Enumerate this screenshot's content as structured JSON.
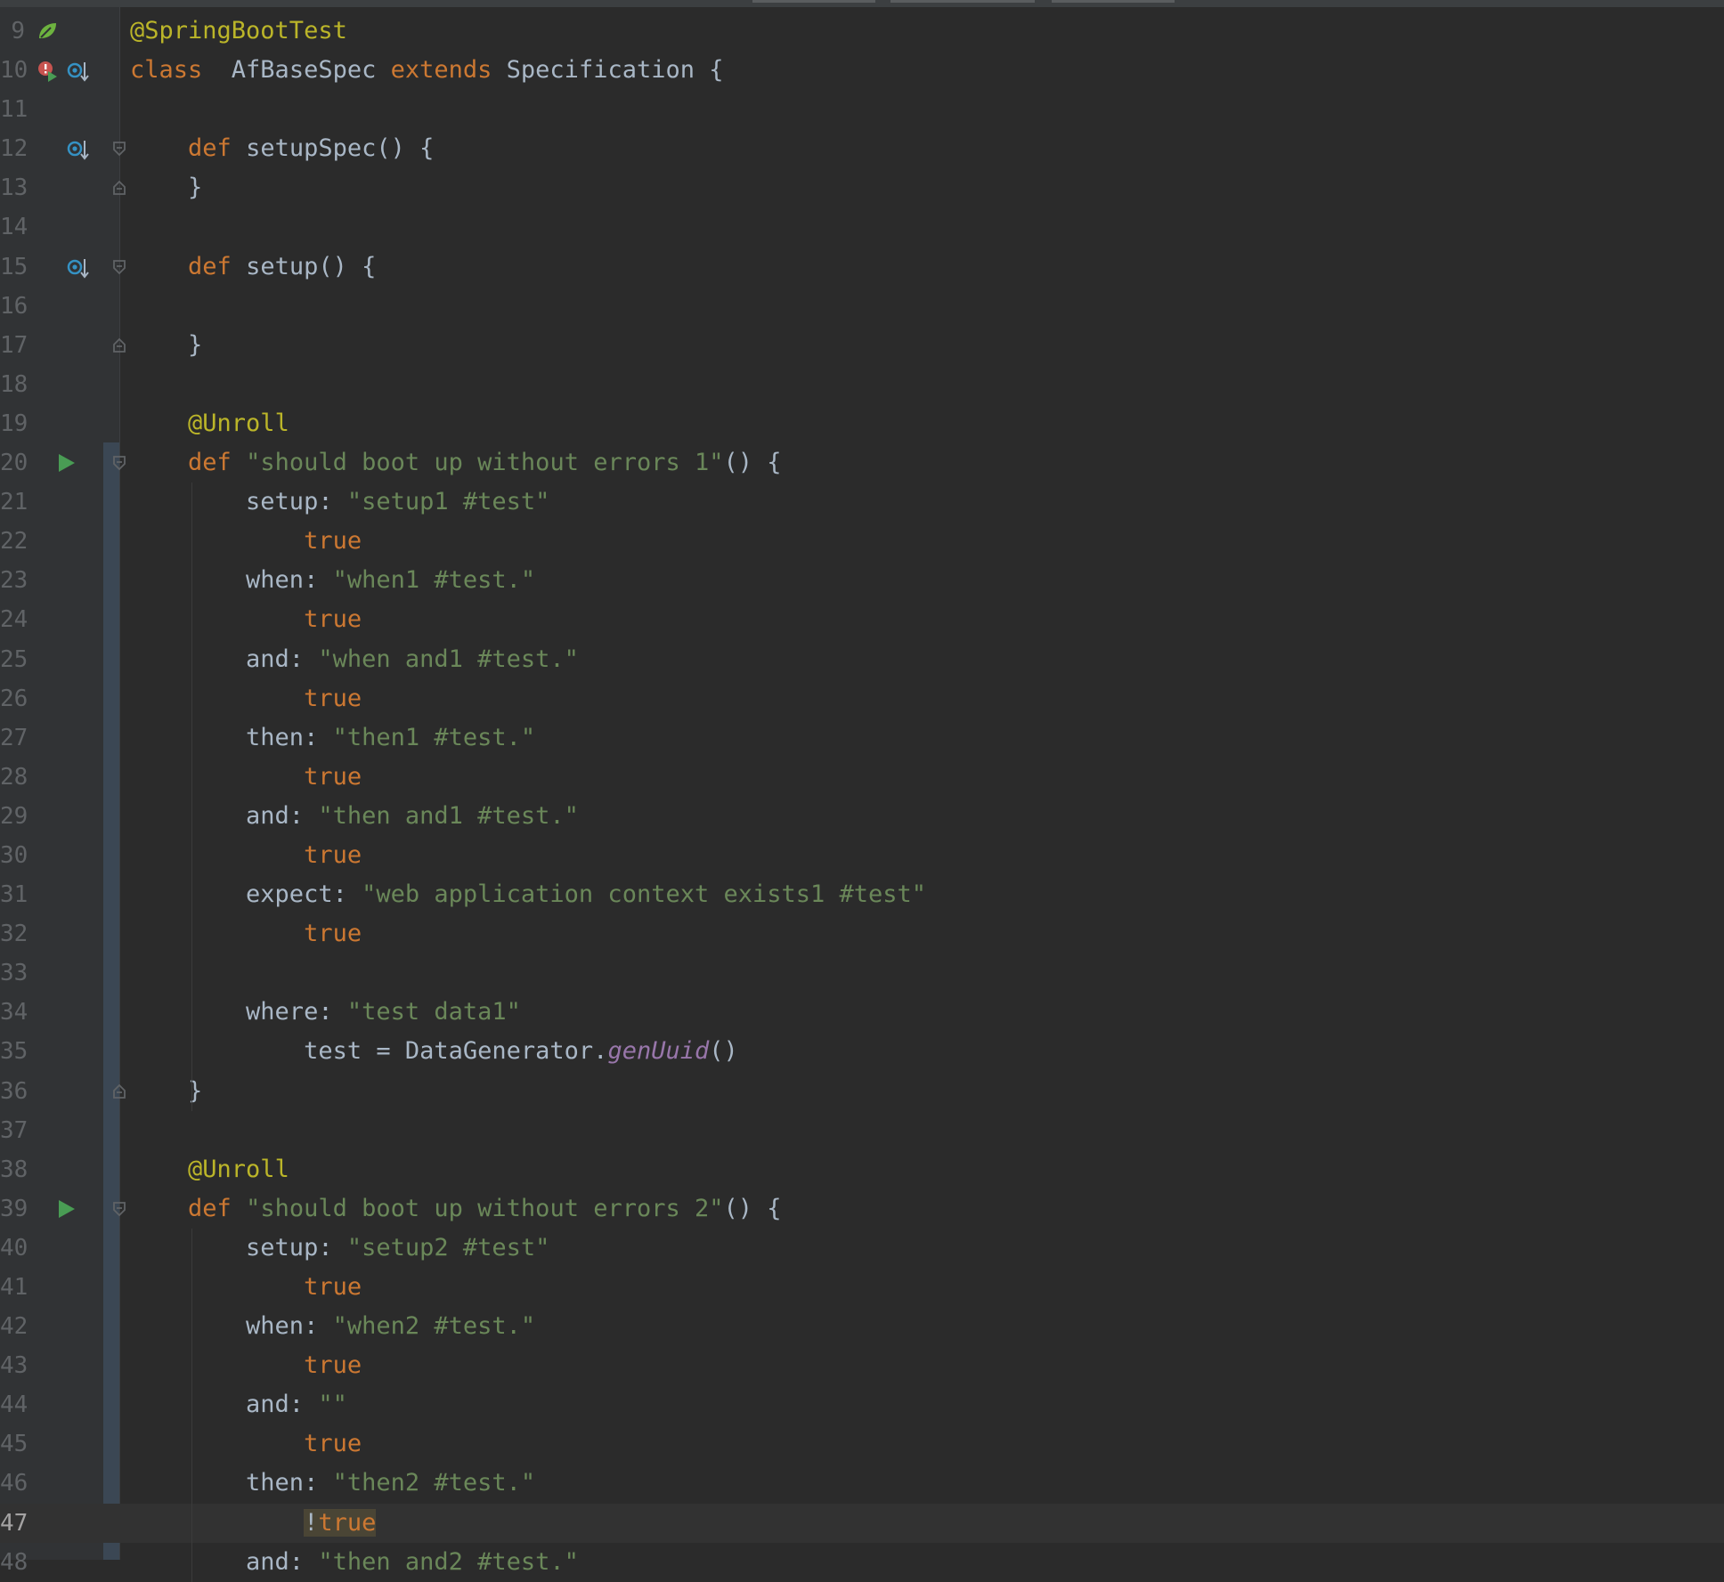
{
  "editor": {
    "language": "groovy",
    "current_line": 47,
    "lines": [
      {
        "n": "9",
        "gutter": [
          "spring-bean-icon"
        ],
        "fold": "",
        "tokens": [
          [
            "an",
            "@SpringBootTest"
          ]
        ]
      },
      {
        "n": "10",
        "gutter": [
          "run-class-icon",
          "implemented-icon"
        ],
        "fold": "",
        "tokens": [
          [
            "kw",
            "class"
          ],
          [
            "",
            "  AfBaseSpec "
          ],
          [
            "kw",
            "extends"
          ],
          [
            "",
            " Specification {"
          ]
        ]
      },
      {
        "n": "11",
        "gutter": [],
        "fold": "",
        "tokens": []
      },
      {
        "n": "12",
        "gutter": [
          "override-method-icon"
        ],
        "fold": "open",
        "tokens": [
          [
            "",
            "    "
          ],
          [
            "kw",
            "def"
          ],
          [
            "",
            " setupSpec() {"
          ]
        ]
      },
      {
        "n": "13",
        "gutter": [],
        "fold": "close",
        "tokens": [
          [
            "",
            "    }"
          ]
        ]
      },
      {
        "n": "14",
        "gutter": [],
        "fold": "",
        "tokens": []
      },
      {
        "n": "15",
        "gutter": [
          "override-method-icon"
        ],
        "fold": "open",
        "tokens": [
          [
            "",
            "    "
          ],
          [
            "kw",
            "def"
          ],
          [
            "",
            " setup() {"
          ]
        ]
      },
      {
        "n": "16",
        "gutter": [],
        "fold": "",
        "tokens": []
      },
      {
        "n": "17",
        "gutter": [],
        "fold": "close",
        "tokens": [
          [
            "",
            "    }"
          ]
        ]
      },
      {
        "n": "18",
        "gutter": [],
        "fold": "",
        "tokens": []
      },
      {
        "n": "19",
        "gutter": [],
        "fold": "",
        "tokens": [
          [
            "",
            "    "
          ],
          [
            "an",
            "@Unroll"
          ]
        ]
      },
      {
        "n": "20",
        "gutter": [
          "run-test-icon"
        ],
        "fold": "open",
        "tokens": [
          [
            "",
            "    "
          ],
          [
            "kw",
            "def"
          ],
          [
            "",
            " "
          ],
          [
            "st",
            "\"should boot up without errors 1\""
          ],
          [
            "",
            "() {"
          ]
        ]
      },
      {
        "n": "21",
        "gutter": [],
        "fold": "",
        "tokens": [
          [
            "",
            "        setup: "
          ],
          [
            "st",
            "\"setup1 #test\""
          ]
        ]
      },
      {
        "n": "22",
        "gutter": [],
        "fold": "",
        "tokens": [
          [
            "",
            "            "
          ],
          [
            "kw",
            "true"
          ]
        ]
      },
      {
        "n": "23",
        "gutter": [],
        "fold": "",
        "tokens": [
          [
            "",
            "        when: "
          ],
          [
            "st",
            "\"when1 #test.\""
          ]
        ]
      },
      {
        "n": "24",
        "gutter": [],
        "fold": "",
        "tokens": [
          [
            "",
            "            "
          ],
          [
            "kw",
            "true"
          ]
        ]
      },
      {
        "n": "25",
        "gutter": [],
        "fold": "",
        "tokens": [
          [
            "",
            "        and: "
          ],
          [
            "st",
            "\"when and1 #test.\""
          ]
        ]
      },
      {
        "n": "26",
        "gutter": [],
        "fold": "",
        "tokens": [
          [
            "",
            "            "
          ],
          [
            "kw",
            "true"
          ]
        ]
      },
      {
        "n": "27",
        "gutter": [],
        "fold": "",
        "tokens": [
          [
            "",
            "        then: "
          ],
          [
            "st",
            "\"then1 #test.\""
          ]
        ]
      },
      {
        "n": "28",
        "gutter": [],
        "fold": "",
        "tokens": [
          [
            "",
            "            "
          ],
          [
            "kw",
            "true"
          ]
        ]
      },
      {
        "n": "29",
        "gutter": [],
        "fold": "",
        "tokens": [
          [
            "",
            "        and: "
          ],
          [
            "st",
            "\"then and1 #test.\""
          ]
        ]
      },
      {
        "n": "30",
        "gutter": [],
        "fold": "",
        "tokens": [
          [
            "",
            "            "
          ],
          [
            "kw",
            "true"
          ]
        ]
      },
      {
        "n": "31",
        "gutter": [],
        "fold": "",
        "tokens": [
          [
            "",
            "        expect: "
          ],
          [
            "st",
            "\"web application context exists1 #test\""
          ]
        ]
      },
      {
        "n": "32",
        "gutter": [],
        "fold": "",
        "tokens": [
          [
            "",
            "            "
          ],
          [
            "kw",
            "true"
          ]
        ]
      },
      {
        "n": "33",
        "gutter": [],
        "fold": "",
        "tokens": []
      },
      {
        "n": "34",
        "gutter": [],
        "fold": "",
        "tokens": [
          [
            "",
            "        where: "
          ],
          [
            "st",
            "\"test data1\""
          ]
        ]
      },
      {
        "n": "35",
        "gutter": [],
        "fold": "",
        "tokens": [
          [
            "",
            "            test = DataGenerator."
          ],
          [
            "mt",
            "genUuid"
          ],
          [
            "",
            "()"
          ]
        ]
      },
      {
        "n": "36",
        "gutter": [],
        "fold": "close",
        "tokens": [
          [
            "",
            "    }"
          ]
        ]
      },
      {
        "n": "37",
        "gutter": [],
        "fold": "",
        "tokens": []
      },
      {
        "n": "38",
        "gutter": [],
        "fold": "",
        "tokens": [
          [
            "",
            "    "
          ],
          [
            "an",
            "@Unroll"
          ]
        ]
      },
      {
        "n": "39",
        "gutter": [
          "run-test-icon"
        ],
        "fold": "open",
        "tokens": [
          [
            "",
            "    "
          ],
          [
            "kw",
            "def"
          ],
          [
            "",
            " "
          ],
          [
            "st",
            "\"should boot up without errors 2\""
          ],
          [
            "",
            "() {"
          ]
        ]
      },
      {
        "n": "40",
        "gutter": [],
        "fold": "",
        "tokens": [
          [
            "",
            "        setup: "
          ],
          [
            "st",
            "\"setup2 #test\""
          ]
        ]
      },
      {
        "n": "41",
        "gutter": [],
        "fold": "",
        "tokens": [
          [
            "",
            "            "
          ],
          [
            "kw",
            "true"
          ]
        ]
      },
      {
        "n": "42",
        "gutter": [],
        "fold": "",
        "tokens": [
          [
            "",
            "        when: "
          ],
          [
            "st",
            "\"when2 #test.\""
          ]
        ]
      },
      {
        "n": "43",
        "gutter": [],
        "fold": "",
        "tokens": [
          [
            "",
            "            "
          ],
          [
            "kw",
            "true"
          ]
        ]
      },
      {
        "n": "44",
        "gutter": [],
        "fold": "",
        "tokens": [
          [
            "",
            "        and: "
          ],
          [
            "st",
            "\"\""
          ]
        ]
      },
      {
        "n": "45",
        "gutter": [],
        "fold": "",
        "tokens": [
          [
            "",
            "            "
          ],
          [
            "kw",
            "true"
          ]
        ]
      },
      {
        "n": "46",
        "gutter": [],
        "fold": "",
        "tokens": [
          [
            "",
            "        then: "
          ],
          [
            "st",
            "\"then2 #test.\""
          ]
        ]
      },
      {
        "n": "47",
        "gutter": [],
        "fold": "",
        "tokens": [
          [
            "",
            "            "
          ],
          [
            "hl",
            "!"
          ],
          [
            "hlkw",
            "true"
          ]
        ]
      },
      {
        "n": "48",
        "gutter": [],
        "fold": "",
        "tokens": [
          [
            "",
            "        and: "
          ],
          [
            "st",
            "\"then and2 #test.\""
          ]
        ]
      }
    ]
  },
  "colors": {
    "background": "#2b2b2b",
    "gutter": "#313335",
    "keyword": "#cc7832",
    "annotation": "#bbb529",
    "string": "#6a8759",
    "method": "#9876aa",
    "text": "#a9b7c6",
    "line_number": "#606366",
    "run_icon": "#499c54"
  }
}
